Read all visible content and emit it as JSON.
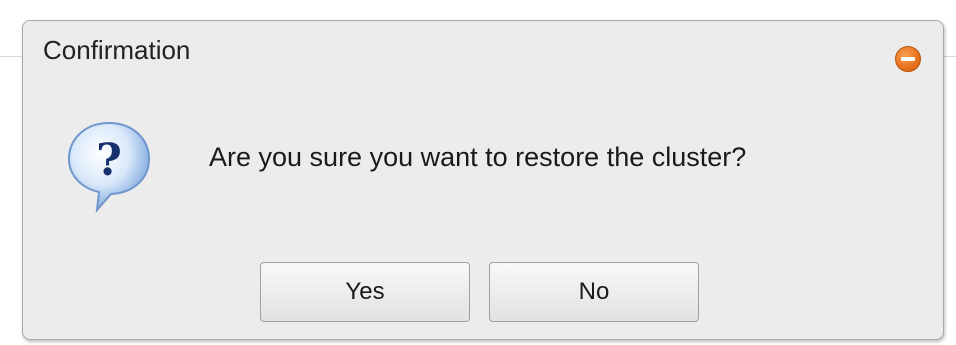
{
  "dialog": {
    "title": "Confirmation",
    "message": "Are you sure you want to restore the cluster?",
    "icons": {
      "question": "question-icon",
      "close": "close-icon"
    },
    "buttons": {
      "yes_label": "Yes",
      "no_label": "No"
    },
    "colors": {
      "close_button": "#e8711d",
      "icon_blue": "#5b8fd6"
    }
  }
}
